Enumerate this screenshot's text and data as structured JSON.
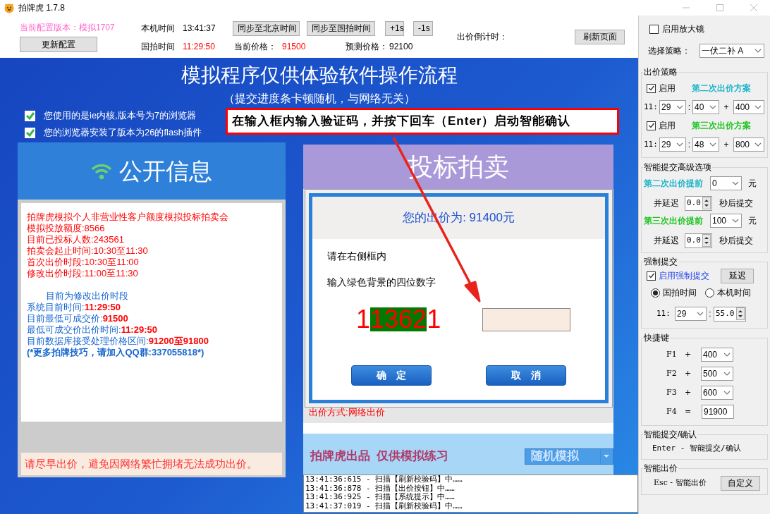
{
  "window": {
    "title": "拍牌虎 1.7.8"
  },
  "toolbar": {
    "config_version": "当前配置版本：模拟1707",
    "update_button": "更新配置",
    "local_time_label": "本机时间",
    "local_time": "13:41:37",
    "sync_buttons": [
      "同步至北京时间",
      "同步至国拍时间",
      "+1s",
      "-1s"
    ],
    "auction_time_label": "国拍时间",
    "auction_time": "11:29:50",
    "current_price_label": "当前价格：",
    "current_price": "91500",
    "predicted_price_label": "预测价格：",
    "predicted_price": "92100",
    "countdown_label": "出价倒计时：",
    "refresh_button": "刷新页面"
  },
  "main": {
    "title": "模拟程序仅供体验软件操作流程",
    "subtitle": "（提交进度条卡顿随机，与网络无关）",
    "checks": [
      {
        "label": "您使用的是ie内核,版本号为7的浏览器",
        "checked": true
      },
      {
        "label": "您的浏览器安装了版本为26的flash插件",
        "checked": true
      }
    ],
    "callout": "在输入框内输入验证码，并按下回车（Enter）启动智能确认"
  },
  "public_info": {
    "title": "公开信息",
    "lines": [
      {
        "kind": "red",
        "text": "拍牌虎模拟个人非营业性客户额度模拟投标拍卖会"
      },
      {
        "kind": "red",
        "text": "模拟投放额度:8566"
      },
      {
        "kind": "red",
        "text": "目前已投标人数:243561"
      },
      {
        "kind": "red",
        "text": "拍卖会起止时间:10:30至11:30"
      },
      {
        "kind": "red",
        "text": "首次出价时段:10:30至11:00"
      },
      {
        "kind": "red",
        "text": "修改出价时段:11:00至11:30"
      },
      {
        "kind": "heading",
        "text": "目前为修改出价时段"
      },
      {
        "kind": "pair",
        "text": "系统目前时间:",
        "value": "11:29:50"
      },
      {
        "kind": "pair",
        "text": "目前最低可成交价:",
        "value": "91500"
      },
      {
        "kind": "pair",
        "text": "最低可成交价出价时间:",
        "value": "11:29:50"
      },
      {
        "kind": "pair",
        "text": "目前数据库接受处理价格区间:",
        "value": "91200至91800"
      },
      {
        "kind": "note",
        "text": "(*更多拍牌技巧，请加入QQ群:337055818*)"
      }
    ],
    "notice": "请尽早出价，避免因网络繁忙拥堵无法成功出价。"
  },
  "bidding": {
    "title": "投标拍卖",
    "method_line": "出价方式:网络出价",
    "footer": "拍牌虎出品  仅供模拟练习",
    "mode_select": "随机模拟"
  },
  "dialog": {
    "bid_line": "您的出价为: 91400元",
    "instructions": [
      "请在右侧框内",
      "输入绿色背景的四位数字"
    ],
    "captcha": [
      {
        "text": "1",
        "highlighted": false
      },
      {
        "text": "1362",
        "highlighted": true
      },
      {
        "text": "1",
        "highlighted": false
      }
    ],
    "confirm_button": "确　定",
    "cancel_button": "取　消"
  },
  "log": [
    "13:41:36:615 - 扫描【刷新校验码】中……",
    "13:41:36:878 - 扫描【出价按钮】中……",
    "13:41:36:925 - 扫描【系统提示】中……",
    "13:41:37:019 - 扫描【刷新校验码】中……"
  ],
  "side": {
    "magnifier": {
      "label": "启用放大镜",
      "checked": false
    },
    "strategy_label": "选择策略：",
    "strategy": "一伏二补 A",
    "bid_strategy": {
      "title": "出价策略",
      "plans": [
        {
          "enable_label": "启用",
          "enabled": true,
          "name": "第二次出价方案",
          "color": "#1ab4c8",
          "hour": "11:",
          "minute": "29",
          "sep": ":",
          "second": "40",
          "plus": "+",
          "add": "400"
        },
        {
          "enable_label": "启用",
          "enabled": true,
          "name": "第三次出价方案",
          "color": "#1cc41c",
          "hour": "11:",
          "minute": "29",
          "sep": ":",
          "second": "48",
          "plus": "+",
          "add": "800"
        }
      ]
    },
    "advanced": {
      "title": "智能提交高级选项",
      "rows": [
        {
          "label": "第二次出价提前",
          "color": "#1ab4c8",
          "amount": "0",
          "unit": "元",
          "delay_label": "并延迟",
          "delay": "0.0",
          "after": "秒后提交"
        },
        {
          "label": "第三次出价提前",
          "color": "#1cc41c",
          "amount": "100",
          "unit": "元",
          "delay_label": "并延迟",
          "delay": "0.0",
          "after": "秒后提交"
        }
      ]
    },
    "force": {
      "title": "强制提交",
      "label": "启用强制提交",
      "enabled": true,
      "delay_button": "延迟",
      "time_sources": [
        {
          "label": "国拍时间",
          "selected": true
        },
        {
          "label": "本机时间",
          "selected": false
        }
      ],
      "hour": "11:",
      "minute": "29",
      "sep": ":",
      "seconds": "55.0"
    },
    "hotkeys": {
      "title": "快捷键",
      "items": [
        {
          "kind": "select",
          "key": "F1",
          "op": "+",
          "value": "400"
        },
        {
          "kind": "select",
          "key": "F2",
          "op": "+",
          "value": "500"
        },
        {
          "kind": "select",
          "key": "F3",
          "op": "+",
          "value": "600"
        },
        {
          "kind": "input",
          "key": "F4",
          "op": "=",
          "value": "91900"
        }
      ]
    },
    "smart_confirm": {
      "title": "智能提交/确认",
      "text": "Enter - 智能提交/确认"
    },
    "smart_bid": {
      "title": "智能出价",
      "text": "Esc - 智能出价",
      "button": "自定义"
    }
  }
}
